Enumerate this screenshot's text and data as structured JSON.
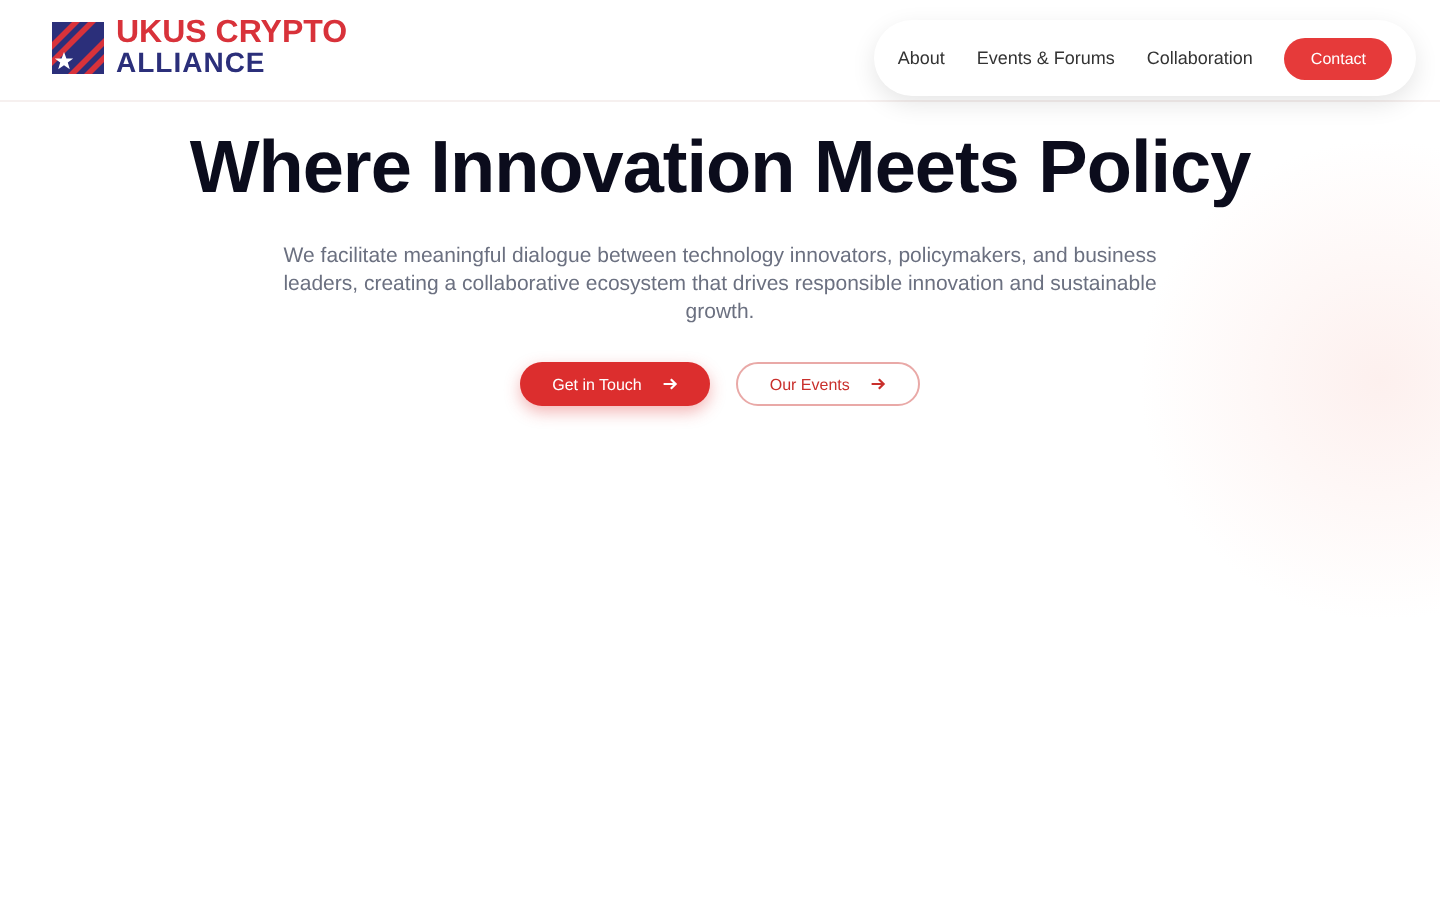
{
  "logo": {
    "line_1": "UKUS CRYPTO",
    "line_2": "ALLIANCE"
  },
  "nav": {
    "links": [
      {
        "label": "About"
      },
      {
        "label": "Events & Forums"
      },
      {
        "label": "Collaboration"
      }
    ],
    "cta": "Contact"
  },
  "hero": {
    "title": "Where Innovation Meets Policy",
    "text": "We facilitate meaningful dialogue between technology innovators, policymakers, and business leaders, creating a collaborative ecosystem that drives responsible innovation and sustainable growth.",
    "buttons": [
      {
        "label": "Get in Touch",
        "kind": "primary"
      },
      {
        "label": "Our Events",
        "kind": "outline"
      }
    ]
  }
}
